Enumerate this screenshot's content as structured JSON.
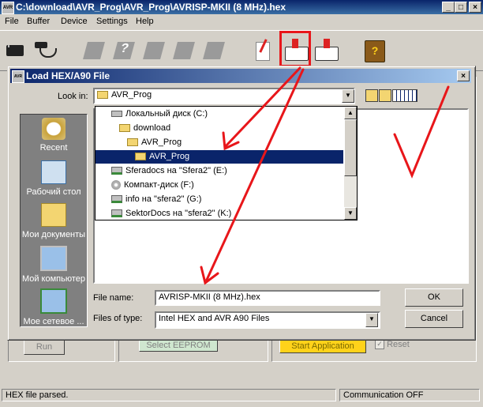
{
  "app": {
    "title": "C:\\download\\AVR_Prog\\AVR_Prog\\AVRISP-MKII (8 MHz).hex",
    "icon_text": "AVR"
  },
  "window_controls": {
    "minimize": "_",
    "maximize": "□",
    "close": "×"
  },
  "menu": [
    "File",
    "Buffer",
    "Device",
    "Settings",
    "Help"
  ],
  "toolbar": {
    "icons": [
      "chip-icon",
      "usb-plug-icon",
      "read-chip-icon",
      "help-chip-icon",
      "erase-chip-icon",
      "verify-chip-icon",
      "lock-chip-icon",
      "blank-check-icon",
      "load-file-icon",
      "save-file-icon",
      "help-book-icon"
    ]
  },
  "background": {
    "run_label": "Run",
    "select_eeprom_label": "Select EEPROM",
    "start_application_label": "Start Application",
    "reset_label": "Reset"
  },
  "status": {
    "left": "HEX file parsed.",
    "right": "Communication OFF"
  },
  "dialog": {
    "title": "Load HEX/A90 File",
    "close": "×",
    "look_in_label": "Look in:",
    "look_in_value": "AVR_Prog",
    "places": [
      "Recent",
      "Рабочий стол",
      "Мои документы",
      "Мой компьютер",
      "Мое сетевое ..."
    ],
    "dropdown_items": [
      {
        "label": "Локальный диск (C:)",
        "icon": "drive-icon",
        "indent": 1
      },
      {
        "label": "download",
        "icon": "folder-icon",
        "indent": 2
      },
      {
        "label": "AVR_Prog",
        "icon": "folder-icon",
        "indent": 3
      },
      {
        "label": "AVR_Prog",
        "icon": "folder-icon",
        "indent": 4,
        "selected": true
      },
      {
        "label": "Sferadocs на \"Sfera2\" (E:)",
        "icon": "network-drive-icon",
        "indent": 1
      },
      {
        "label": "Компакт-диск (F:)",
        "icon": "cd-icon",
        "indent": 1
      },
      {
        "label": "info на \"sfera2\" (G:)",
        "icon": "network-drive-icon",
        "indent": 1
      },
      {
        "label": "SektorDocs на \"sfera2\" (K:)",
        "icon": "network-drive-icon",
        "indent": 1
      }
    ],
    "file_name_label": "File name:",
    "file_name_value": "AVRISP-MKII (8 MHz).hex",
    "files_of_type_label": "Files of type:",
    "files_of_type_value": "Intel HEX and AVR A90 Files",
    "ok_label": "OK",
    "cancel_label": "Cancel"
  },
  "colors": {
    "annotation_red": "#e8161a",
    "titlebar": "#0a246a",
    "selection": "#0a246a",
    "highlight_button": "#ffd21a"
  }
}
